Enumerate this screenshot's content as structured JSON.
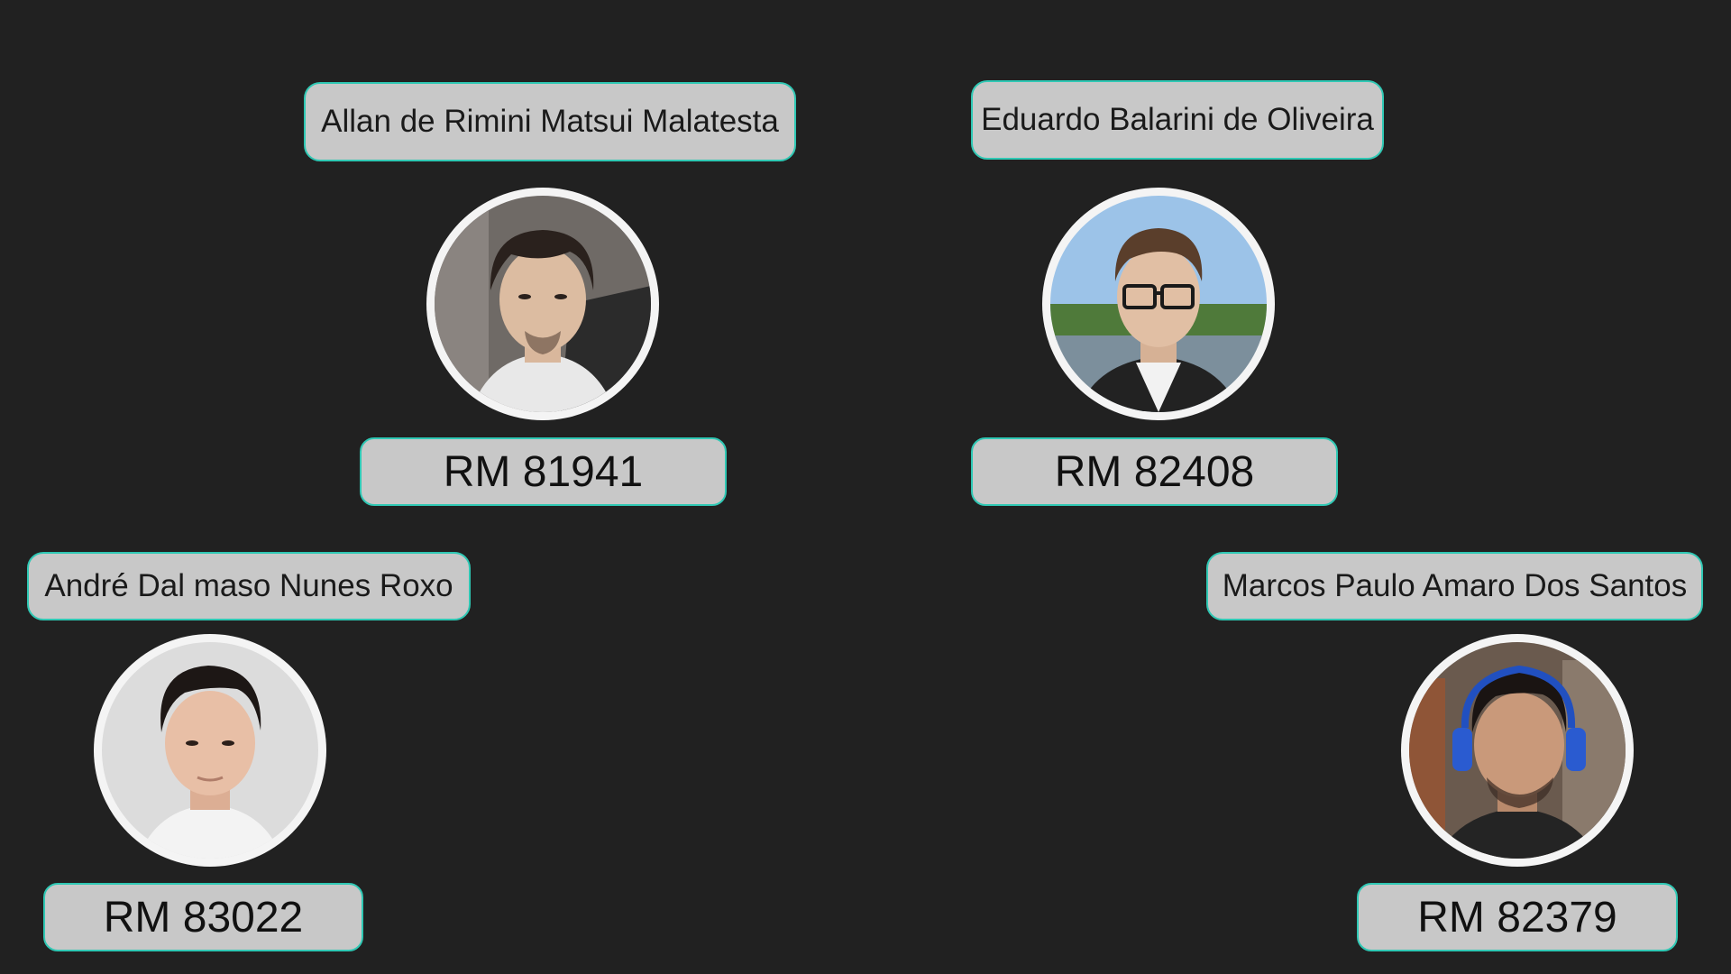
{
  "members": [
    {
      "name": "Allan de Rimini Matsui Malatesta",
      "rm": "RM 81941"
    },
    {
      "name": "Eduardo Balarini de Oliveira",
      "rm": "RM 82408"
    },
    {
      "name": "André Dal maso Nunes Roxo",
      "rm": "RM 83022"
    },
    {
      "name": "Marcos Paulo Amaro Dos Santos",
      "rm": "RM 82379"
    }
  ],
  "colors": {
    "background": "#212121",
    "box_fill": "#c8c8c8",
    "box_border": "#2fc8b4"
  }
}
